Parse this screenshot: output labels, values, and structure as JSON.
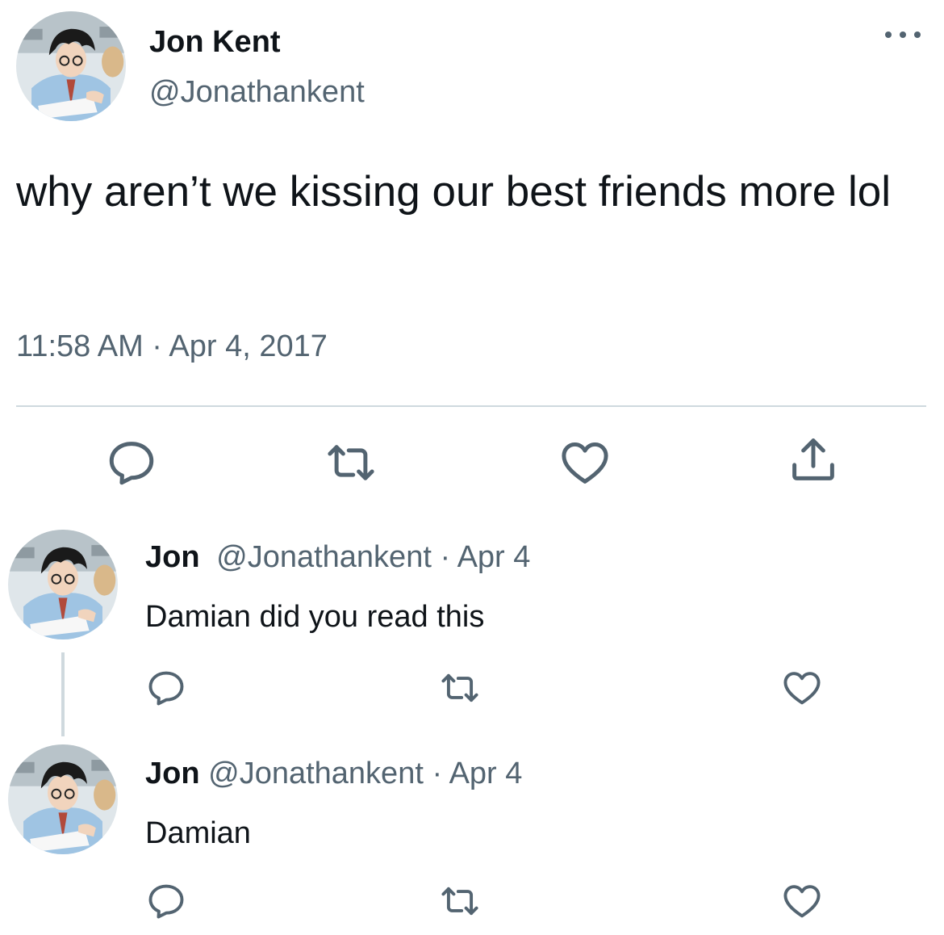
{
  "tweet": {
    "author_name": "Jon Kent",
    "author_handle": "@Jonathankent",
    "text": "why aren’t we kissing our best friends more lol",
    "timestamp": "11:58 AM · Apr 4, 2017",
    "actions": [
      "reply-icon",
      "retweet-icon",
      "like-icon",
      "share-icon"
    ]
  },
  "replies": [
    {
      "name": "Jon",
      "handle": "@Jonathankent",
      "date": "Apr 4",
      "text": "Damian did you read this"
    },
    {
      "name": "Jon",
      "handle": "@Jonathankent",
      "date": "Apr 4",
      "text": "Damian"
    }
  ],
  "colors": {
    "text": "#0f1419",
    "secondary": "#536471",
    "divider": "#cfd9de"
  }
}
